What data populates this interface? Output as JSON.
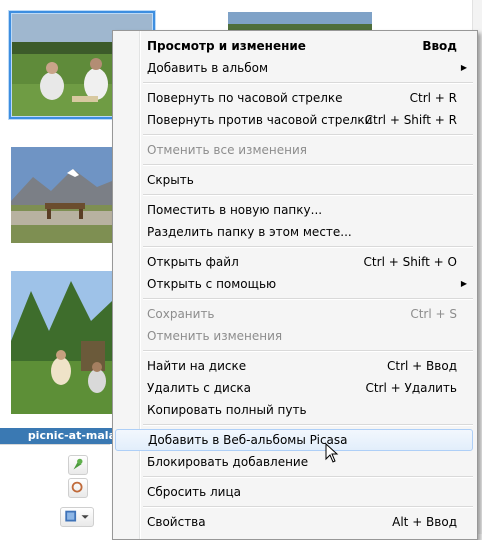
{
  "gallery": {
    "caption": "picnic-at-malа",
    "thumbnails": [
      {
        "id": "picnic-meadow"
      },
      {
        "id": "sky-top"
      },
      {
        "id": "mountain-lake-table"
      },
      {
        "id": "forest-picnic"
      }
    ]
  },
  "context_menu": {
    "items": [
      {
        "label": "Просмотр и изменение",
        "shortcut": "Ввод",
        "bold": true
      },
      {
        "label": "Добавить в альбом",
        "shortcut": "",
        "submenu": true
      },
      {
        "label": "Повернуть по часовой стрелке",
        "shortcut": "Ctrl + R"
      },
      {
        "label": "Повернуть против часовой стрелки",
        "shortcut": "Ctrl + Shift + R"
      },
      {
        "label": "Отменить все изменения",
        "shortcut": "",
        "disabled": true
      },
      {
        "label": "Скрыть",
        "shortcut": ""
      },
      {
        "label": "Поместить в новую папку...",
        "shortcut": ""
      },
      {
        "label": "Разделить папку в этом месте...",
        "shortcut": ""
      },
      {
        "label": "Открыть файл",
        "shortcut": "Ctrl + Shift + O"
      },
      {
        "label": "Открыть с помощью",
        "shortcut": "",
        "submenu": true
      },
      {
        "label": "Сохранить",
        "shortcut": "Ctrl + S",
        "disabled": true
      },
      {
        "label": "Отменить изменения",
        "shortcut": "",
        "disabled": true
      },
      {
        "label": "Найти на диске",
        "shortcut": "Ctrl + Ввод"
      },
      {
        "label": "Удалить с диска",
        "shortcut": "Ctrl + Удалить"
      },
      {
        "label": "Копировать полный путь",
        "shortcut": ""
      },
      {
        "label": "Добавить в Веб-альбомы Picasa",
        "shortcut": "",
        "hovered": true
      },
      {
        "label": "Блокировать добавление",
        "shortcut": ""
      },
      {
        "label": "Сбросить лица",
        "shortcut": ""
      },
      {
        "label": "Свойства",
        "shortcut": "Alt + Ввод"
      }
    ]
  },
  "side_panel": {
    "icons": [
      "pin-icon",
      "circle-icon",
      "photo-export-icon"
    ]
  },
  "colors": {
    "menu_bg": "#f5f5f5",
    "hover_border": "#aecff7",
    "caption_bg": "#3a79b3",
    "selection": "#3d8ee0"
  }
}
